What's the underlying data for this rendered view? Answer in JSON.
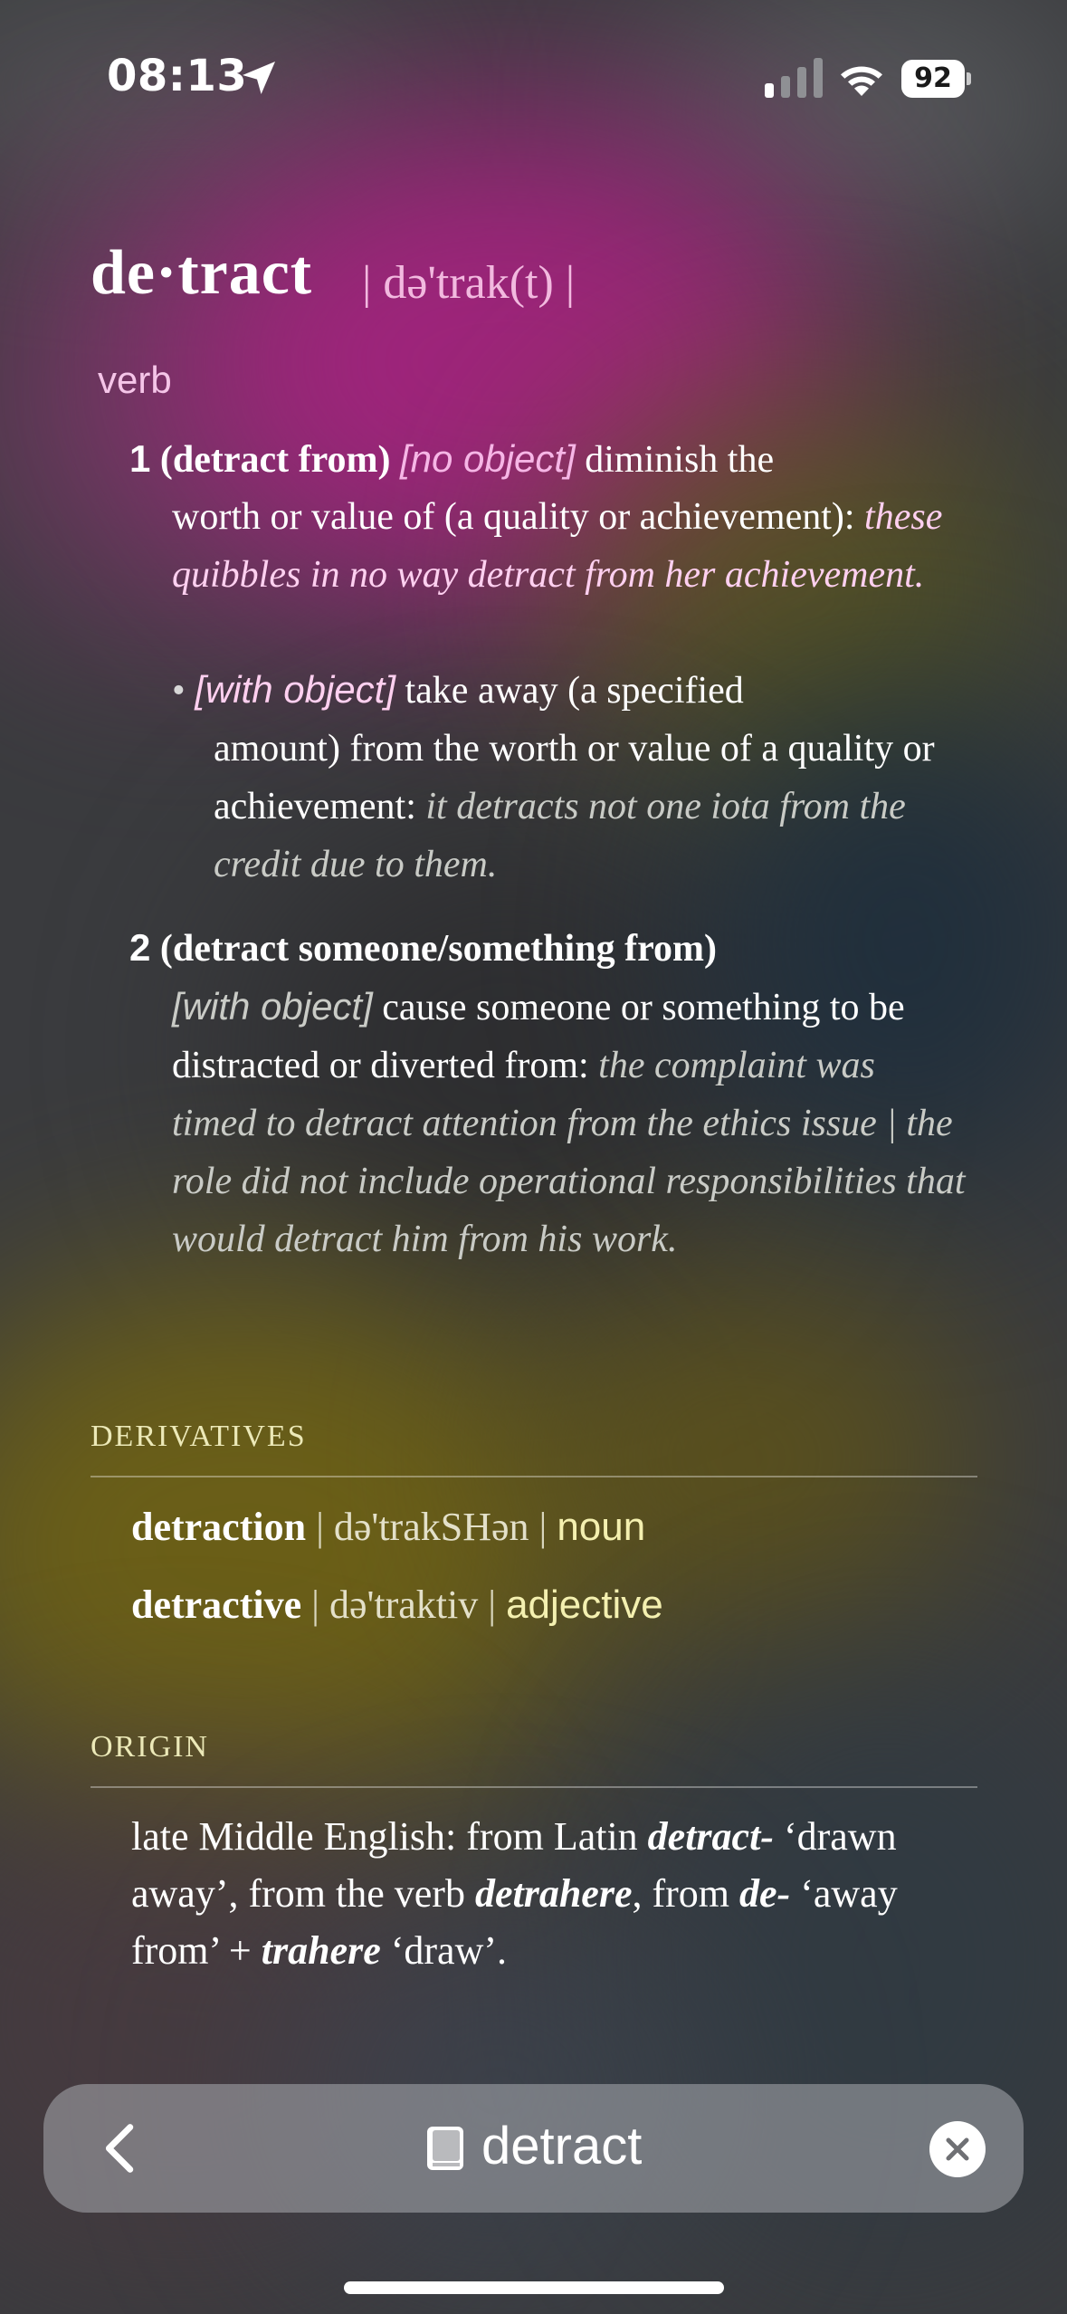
{
  "status_bar": {
    "time": "08:13",
    "battery": "92"
  },
  "entry": {
    "headword": "de·tract",
    "pronunciation": "| də'trak(t) |",
    "part_of_speech": "verb",
    "senses": [
      {
        "number": "1",
        "phrase": "(detract from)",
        "label": "[no object]",
        "definition_start": "diminish the",
        "definition_rest": "worth or value of (a quality or achievement):",
        "example": "these quibbles in no way detract from her achievement.",
        "subsense": {
          "bullet": "•",
          "label": "[with object]",
          "definition_start": "take away (a specified",
          "definition_rest": "amount) from the worth or value of a quality or achievement:",
          "example": "it detracts not one iota from the credit due to them."
        }
      },
      {
        "number": "2",
        "phrase": "(detract someone/something from)",
        "label": "[with object]",
        "definition_start": "cause someone or",
        "definition_rest": "something to be distracted or diverted from:",
        "example": "the complaint was timed to detract attention from the ethics issue | the role did not include operational responsibilities that would detract him from his work."
      }
    ]
  },
  "derivatives": {
    "title": "DERIVATIVES",
    "items": [
      {
        "word": "detraction",
        "pron": "də'trakSHən",
        "pos": "noun"
      },
      {
        "word": "detractive",
        "pron": "də'traktiv",
        "pos": "adjective"
      }
    ]
  },
  "origin": {
    "title": "ORIGIN",
    "t1": "late Middle English: from Latin ",
    "w1": "detract-",
    "t2": " ‘drawn away’, from the verb ",
    "w2": "detrahere",
    "t3": ", from ",
    "w3": "de-",
    "t4": " ‘away from’ + ",
    "w4": "trahere",
    "t5": " ‘draw’."
  },
  "search_bar": {
    "query": "detract"
  },
  "icons": {
    "location": "location-arrow-icon",
    "signal": "cellular-signal-icon",
    "wifi": "wifi-icon",
    "battery": "battery-icon",
    "back": "chevron-left-icon",
    "book": "book-icon",
    "clear": "clear-x-icon"
  },
  "colors": {
    "pronunciation": "#f2b9df",
    "label_pink": "#f6b6e6",
    "section_title": "#ece9b8",
    "derivative_pos": "#f4f0b0"
  }
}
